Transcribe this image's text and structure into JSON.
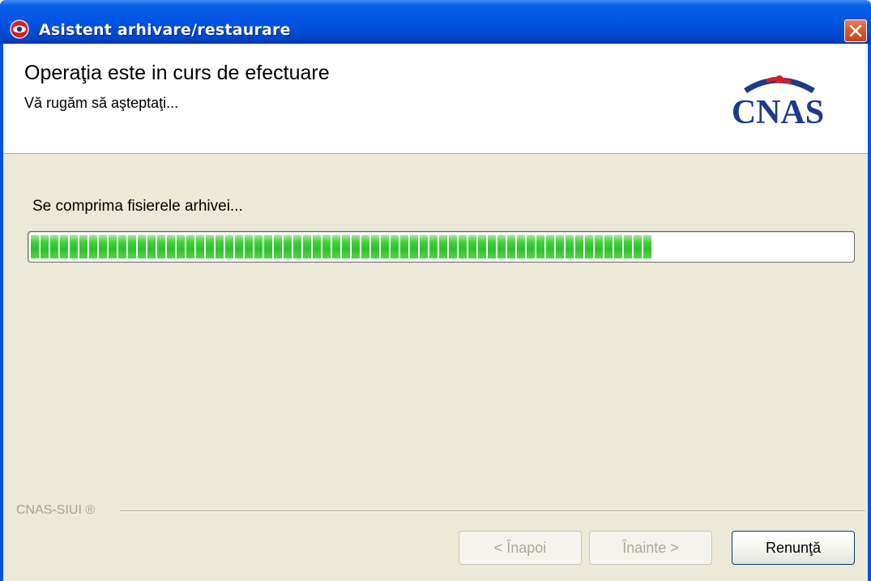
{
  "window": {
    "title": "Asistent arhivare/restaurare",
    "close_label": "×"
  },
  "header": {
    "title": "Operaţia este in curs de efectuare",
    "subtitle": "Vă rugăm să aşteptaţi...",
    "logo_text": "CNAS"
  },
  "progress": {
    "status_text": "Se comprima fisierele arhivei...",
    "filled_fraction": 0.76,
    "accent": "#2fc12b"
  },
  "footer": {
    "brand": "CNAS-SIUI ®",
    "back_label": "< Înapoi",
    "next_label": "Înainte >",
    "cancel_label": "Renunţă"
  },
  "colors": {
    "titlebar": "#0054e3",
    "close": "#d9572f",
    "logo_blue": "#1d3a8a",
    "logo_red": "#d61f26"
  }
}
